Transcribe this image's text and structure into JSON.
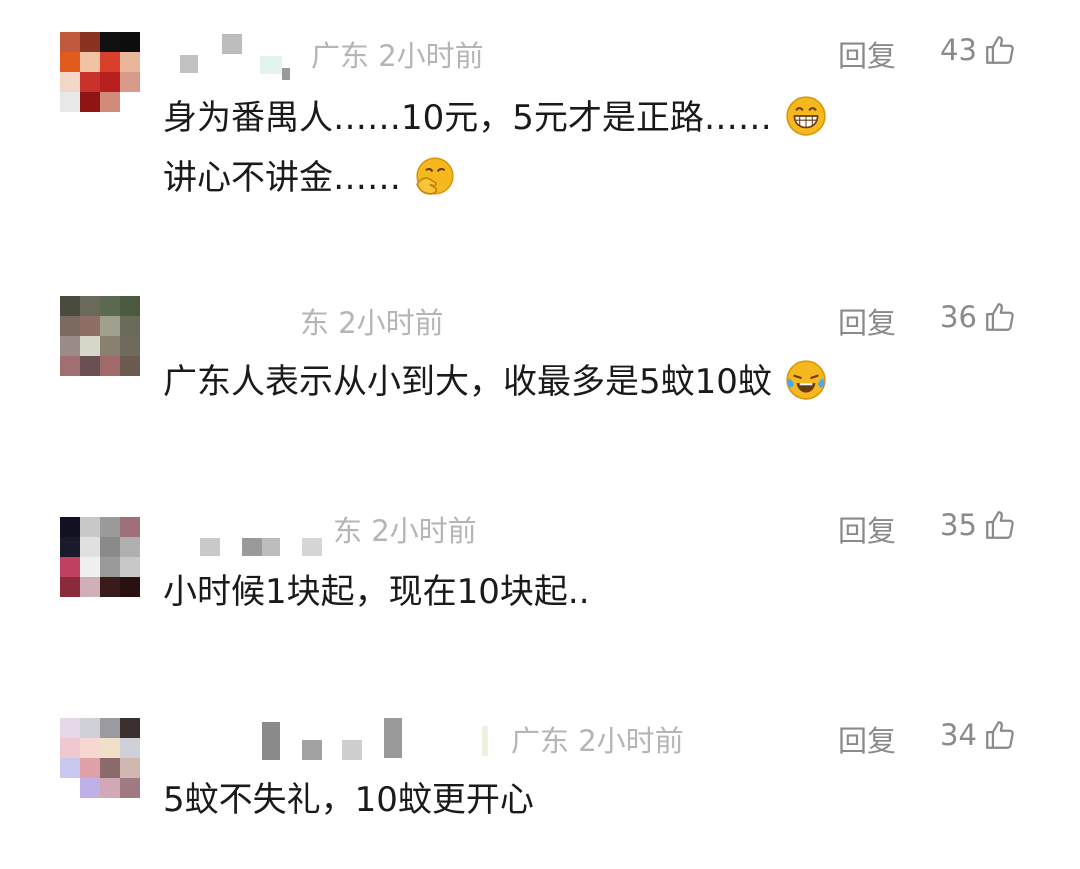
{
  "comments": [
    {
      "location": "广东",
      "time": "2小时前",
      "reply_label": "回复",
      "likes": "43",
      "line1": "身为番禺人……10元，5元才是正路……",
      "line1_emoji": "grinning-emoji",
      "line2": "讲心不讲金……",
      "line2_emoji": "smirking-hand-emoji"
    },
    {
      "location": "东",
      "time": "2小时前",
      "reply_label": "回复",
      "likes": "36",
      "line1": "广东人表示从小到大，收最多是5蚊10蚊",
      "line1_emoji": "crying-laughing-emoji"
    },
    {
      "location": "东",
      "time": "2小时前",
      "reply_label": "回复",
      "likes": "35",
      "line1": "小时候1块起，现在10块起.."
    },
    {
      "location": "广东",
      "time": "2小时前",
      "reply_label": "回复",
      "likes": "34",
      "line1": "5蚊不失礼，10蚊更开心"
    }
  ],
  "icons": {
    "like": "thumbs-up-outline-icon"
  },
  "colors": {
    "meta": "#b5b5b5",
    "action": "#8a8a8a",
    "text": "#1a1a1a",
    "emoji": "#f5b91e"
  }
}
